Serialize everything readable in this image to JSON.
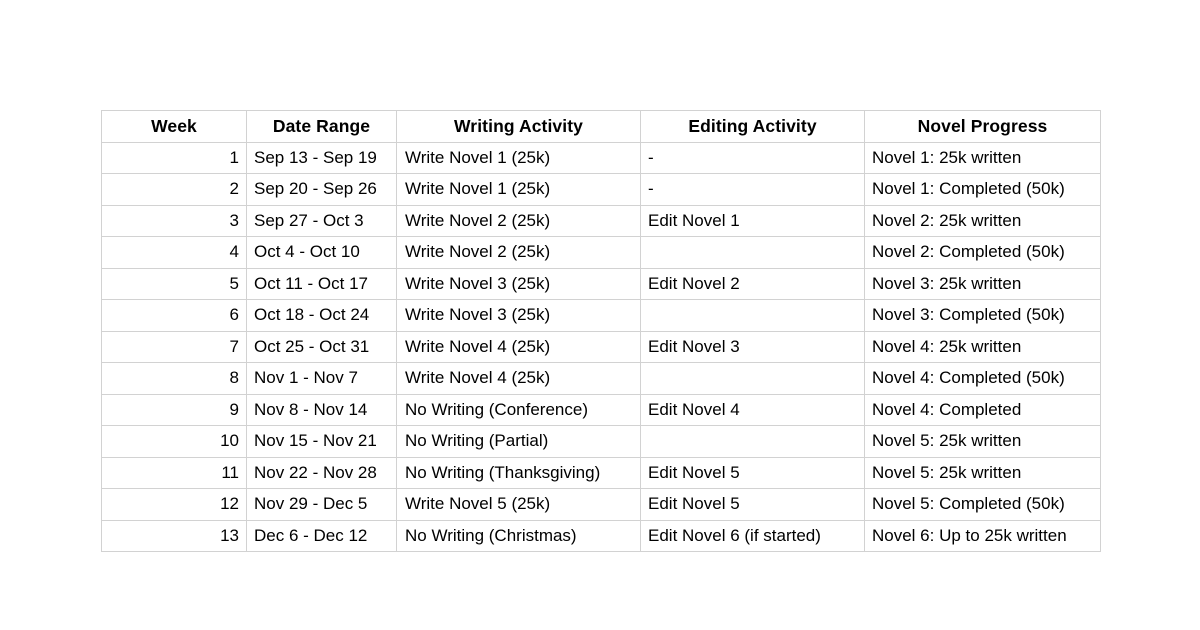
{
  "table": {
    "columns": [
      {
        "key": "week",
        "label": "Week"
      },
      {
        "key": "date",
        "label": "Date Range"
      },
      {
        "key": "writing",
        "label": "Writing Activity"
      },
      {
        "key": "editing",
        "label": "Editing Activity"
      },
      {
        "key": "progress",
        "label": "Novel Progress"
      }
    ],
    "rows": [
      {
        "week": "1",
        "date": "Sep 13 - Sep 19",
        "writing": "Write Novel 1 (25k)",
        "editing": "-",
        "progress": "Novel 1: 25k written"
      },
      {
        "week": "2",
        "date": "Sep 20 - Sep 26",
        "writing": "Write Novel 1 (25k)",
        "editing": "-",
        "progress": "Novel 1: Completed (50k)"
      },
      {
        "week": "3",
        "date": "Sep 27 - Oct 3",
        "writing": "Write Novel 2 (25k)",
        "editing": "Edit Novel 1",
        "progress": "Novel 2: 25k written"
      },
      {
        "week": "4",
        "date": "Oct 4 - Oct 10",
        "writing": "Write Novel 2 (25k)",
        "editing": "",
        "progress": "Novel 2: Completed (50k)"
      },
      {
        "week": "5",
        "date": "Oct 11 - Oct 17",
        "writing": "Write Novel 3 (25k)",
        "editing": "Edit Novel 2",
        "progress": "Novel 3: 25k written"
      },
      {
        "week": "6",
        "date": "Oct 18 - Oct 24",
        "writing": "Write Novel 3 (25k)",
        "editing": "",
        "progress": "Novel 3: Completed (50k)"
      },
      {
        "week": "7",
        "date": "Oct 25 - Oct 31",
        "writing": "Write Novel 4 (25k)",
        "editing": "Edit Novel 3",
        "progress": "Novel 4: 25k written"
      },
      {
        "week": "8",
        "date": "Nov 1 - Nov 7",
        "writing": "Write Novel 4 (25k)",
        "editing": "",
        "progress": "Novel 4: Completed (50k)"
      },
      {
        "week": "9",
        "date": "Nov 8 - Nov 14",
        "writing": "No Writing (Conference)",
        "editing": "Edit Novel 4",
        "progress": "Novel 4: Completed"
      },
      {
        "week": "10",
        "date": "Nov 15 - Nov 21",
        "writing": "No Writing (Partial)",
        "editing": "",
        "progress": "Novel 5: 25k written"
      },
      {
        "week": "11",
        "date": "Nov 22 - Nov 28",
        "writing": "No Writing (Thanksgiving)",
        "editing": "Edit Novel 5",
        "progress": "Novel 5: 25k written"
      },
      {
        "week": "12",
        "date": "Nov 29 - Dec 5",
        "writing": "Write Novel 5 (25k)",
        "editing": "Edit Novel 5",
        "progress": "Novel 5: Completed (50k)"
      },
      {
        "week": "13",
        "date": "Dec 6 - Dec 12",
        "writing": "No Writing (Christmas)",
        "editing": "Edit Novel 6 (if started)",
        "progress": "Novel 6: Up to 25k written"
      }
    ]
  },
  "colors": {
    "border": "#d2d2d2",
    "text": "#000000",
    "background": "#ffffff"
  }
}
